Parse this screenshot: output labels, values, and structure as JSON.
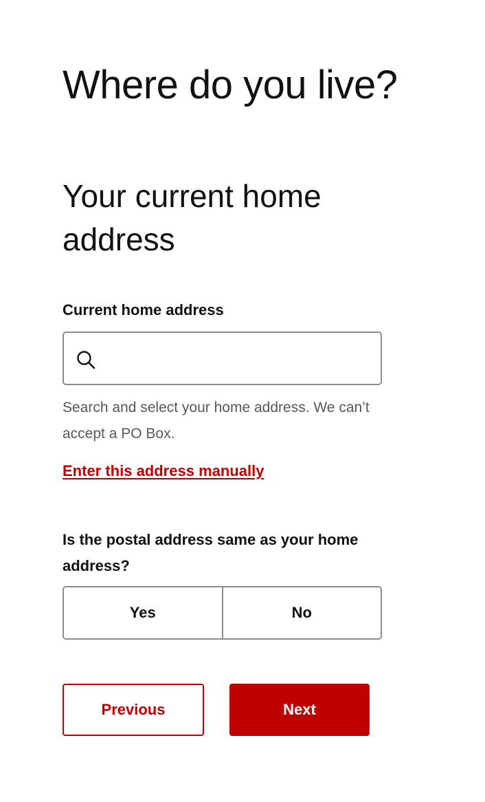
{
  "page": {
    "title": "Where do you live?",
    "section_title": "Your current home address"
  },
  "address": {
    "label": "Current home address",
    "value": "",
    "placeholder": "",
    "hint": "Search and select your home address. We can’t accept a PO Box.",
    "manual_link": "Enter this address manually",
    "icon": "search-icon"
  },
  "postal": {
    "question": "Is the postal address same as your home address?",
    "options": [
      "Yes",
      "No"
    ]
  },
  "navigation": {
    "previous_label": "Previous",
    "next_label": "Next"
  },
  "colors": {
    "accent": "#c00000",
    "border": "#8c8c8c",
    "hint_text": "#575757"
  }
}
